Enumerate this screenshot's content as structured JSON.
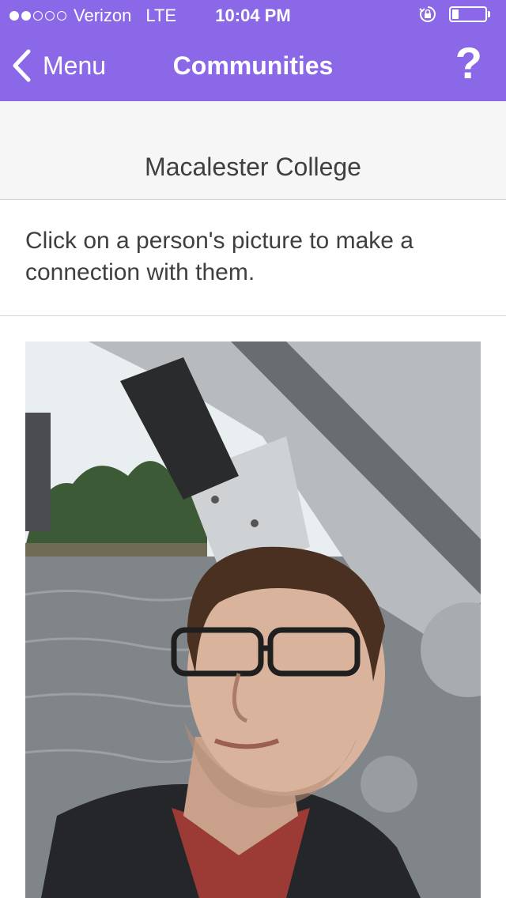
{
  "status_bar": {
    "signal_dots": [
      true,
      true,
      false,
      false,
      false
    ],
    "carrier": "Verizon",
    "network": "LTE",
    "time": "10:04 PM",
    "battery_level": 0.2,
    "icons": [
      "orientation-lock-icon",
      "battery-icon"
    ]
  },
  "nav": {
    "back_label": "Menu",
    "title": "Communities",
    "help_label": "?",
    "back_icon": "chevron-left-icon"
  },
  "community": {
    "name": "Macalester College",
    "instructions": "Click on a person's picture to make a connection with them."
  },
  "colors": {
    "accent": "#8b68e8",
    "header_bg": "#f6f6f6",
    "text": "#3f3f3f"
  }
}
